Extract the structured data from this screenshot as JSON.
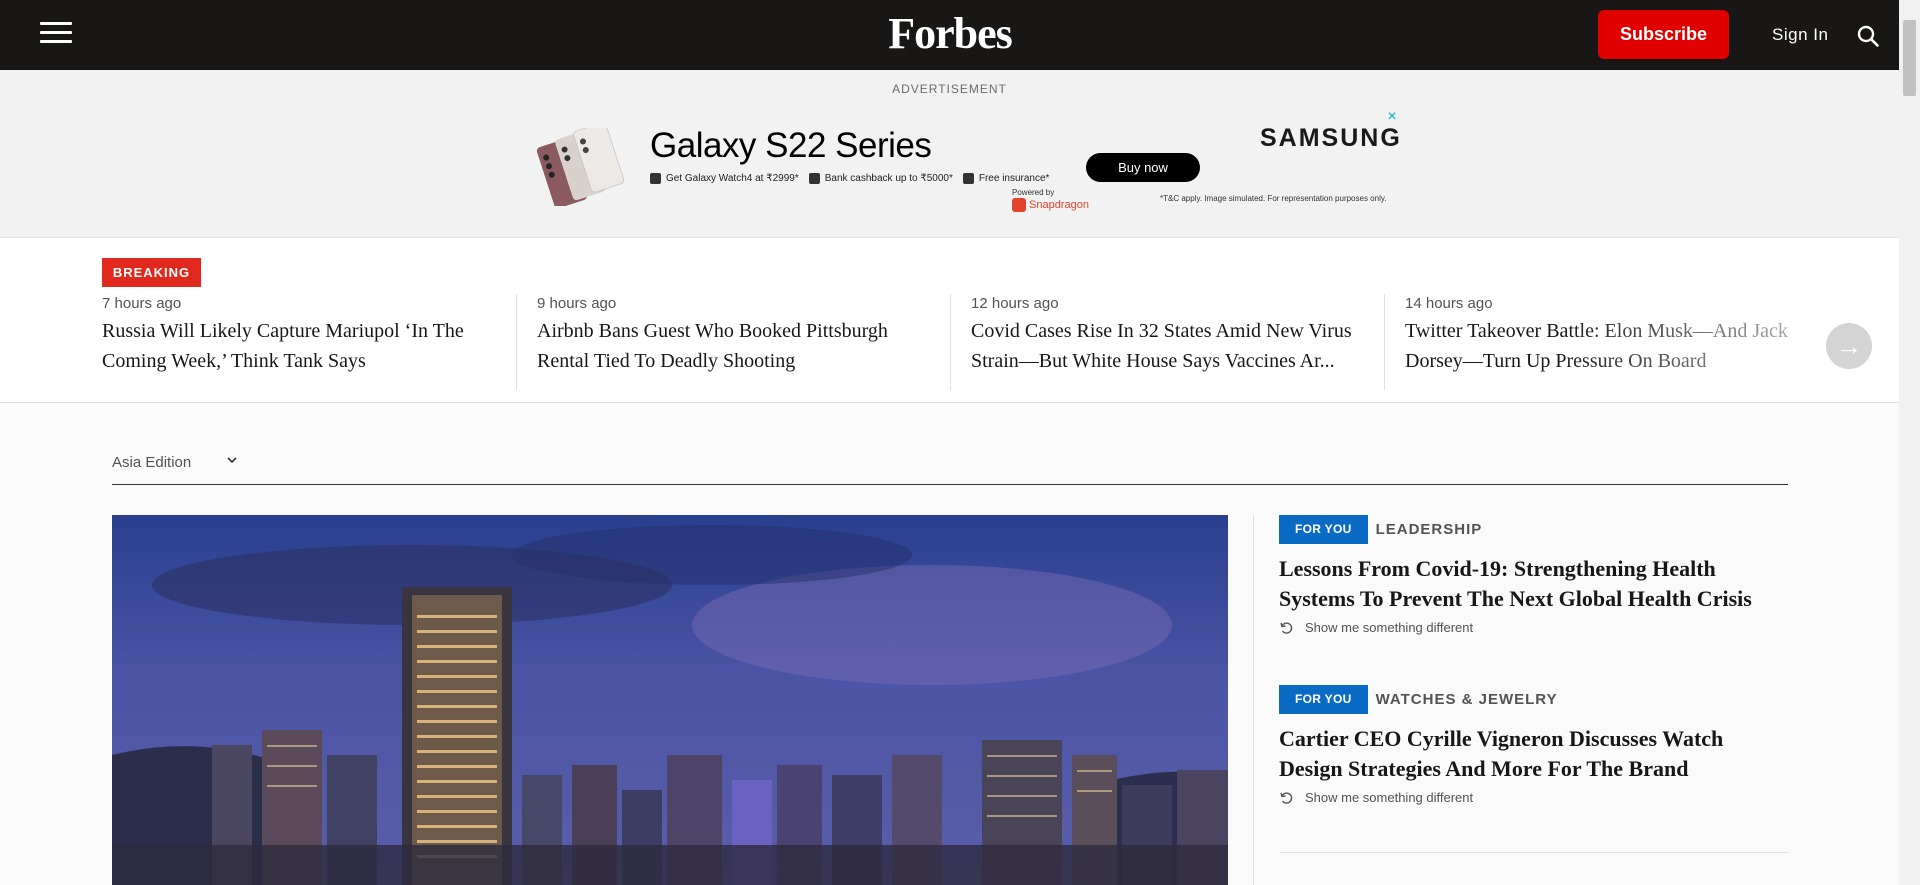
{
  "header": {
    "logo": "Forbes",
    "subscribe_label": "Subscribe",
    "signin_label": "Sign In",
    "menu_icon": "hamburger-menu-icon",
    "search_icon": "search-icon"
  },
  "ad": {
    "label": "ADVERTISEMENT",
    "headline": "Galaxy S22 Series",
    "offers": [
      "Get Galaxy Watch4 at ₹2999*",
      "Bank cashback up to ₹5000*",
      "Free insurance*"
    ],
    "cta": "Buy now",
    "powered_by": "Powered by",
    "powered_brand": "Snapdragon",
    "disclaimer": "*T&C apply. Image simulated. For representation purposes only.",
    "brand": "SAMSUNG",
    "close_glyph": "×"
  },
  "breaking": {
    "badge": "BREAKING",
    "items": [
      {
        "time": "7 hours ago",
        "title": "Russia Will Likely Capture Mariupol ‘In The Coming Week,’ Think Tank Says"
      },
      {
        "time": "9 hours ago",
        "title": "Airbnb Bans Guest Who Booked Pittsburgh Rental Tied To Deadly Shooting"
      },
      {
        "time": "12 hours ago",
        "title": "Covid Cases Rise In 32 States Amid New Virus Strain—But White House Says Vaccines Ar..."
      },
      {
        "time": "14 hours ago",
        "title": "Twitter Takeover Battle: Elon Musk—And Jack Dorsey—Turn Up Pressure On Board"
      }
    ],
    "next_glyph": "→"
  },
  "edition": {
    "label": "Asia Edition"
  },
  "for_you": [
    {
      "badge": "FOR YOU",
      "category": "LEADERSHIP",
      "title": "Lessons From Covid-19: Strengthening Health Systems To Prevent The Next Global Health Crisis",
      "more": "Show me something different"
    },
    {
      "badge": "FOR YOU",
      "category": "WATCHES & JEWELRY",
      "title": "Cartier CEO Cyrille Vigneron Discusses Watch Design Strategies And More For The Brand",
      "more": "Show me something different"
    }
  ],
  "colors": {
    "header_bg": "#181716",
    "subscribe": "#e00000",
    "breaking": "#e0281c",
    "for_you": "#0a6bc4"
  }
}
